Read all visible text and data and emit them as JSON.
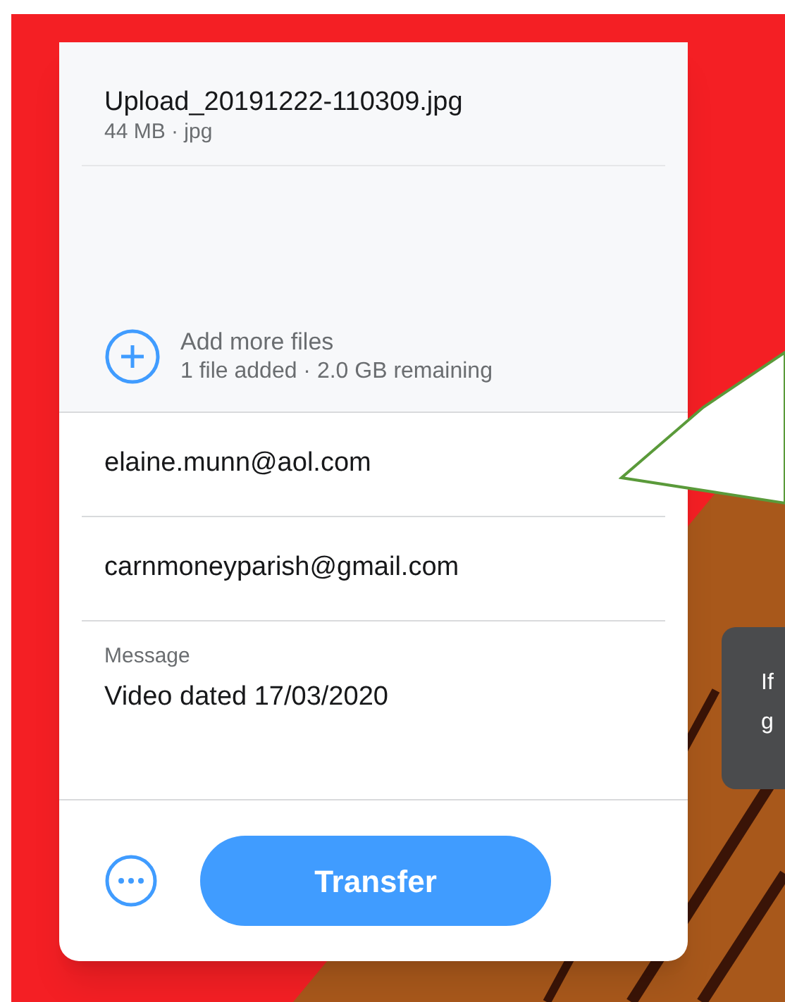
{
  "file": {
    "name": "Upload_20191222-110309.jpg",
    "meta": "44 MB · jpg"
  },
  "add_files": {
    "label": "Add more files",
    "status": "1 file added · 2.0 GB remaining"
  },
  "recipients": [
    "elaine.munn@aol.com",
    "carnmoneyparish@gmail.com"
  ],
  "message": {
    "label": "Message",
    "value": "Video dated 17/03/2020"
  },
  "transfer_button": "Transfer",
  "tooltip": {
    "lines": [
      "If",
      "g"
    ]
  }
}
